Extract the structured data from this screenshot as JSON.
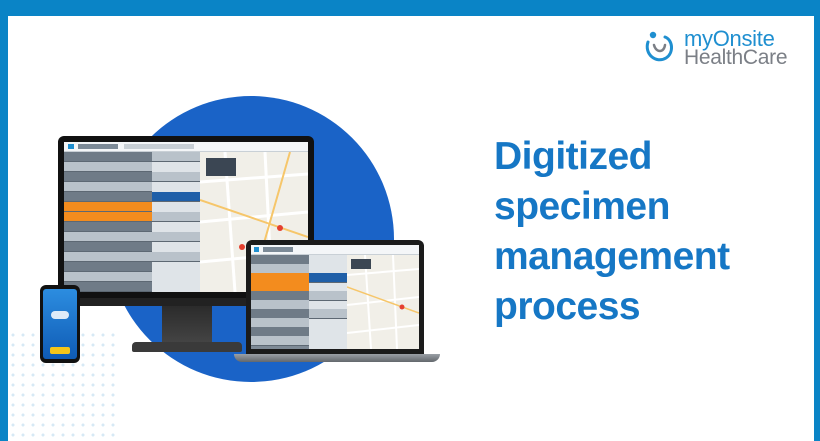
{
  "brand": {
    "line1": "myOnsite",
    "line2": "HealthCare",
    "primary_color": "#1f8fd0",
    "secondary_color": "#7b7f86"
  },
  "headline": {
    "lines": [
      "Digitized",
      "specimen",
      "management",
      "process"
    ],
    "color": "#1677c5"
  },
  "colors": {
    "frame": "#0a84c6",
    "circle": "#1a63c7",
    "highlight_row": "#f38c1e"
  },
  "devices": [
    "desktop-monitor",
    "laptop",
    "smartphone"
  ]
}
